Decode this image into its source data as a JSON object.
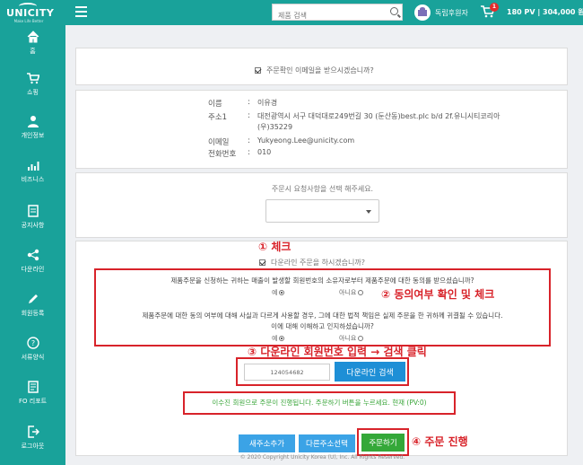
{
  "header": {
    "logo_text": "UNICITY",
    "logo_tagline": "Make Life Better",
    "search_placeholder": "제품 검색",
    "rank_label": "독립후원자",
    "cart_count": "1",
    "totals": "180 PV  |  304,000 원"
  },
  "sidebar": {
    "items": [
      {
        "label": "홈",
        "icon": "home-icon"
      },
      {
        "label": "쇼핑",
        "icon": "shopping-cart-icon"
      },
      {
        "label": "개인정보",
        "icon": "user-icon"
      },
      {
        "label": "비즈니스",
        "icon": "bar-chart-icon"
      },
      {
        "label": "공지사항",
        "icon": "notice-icon"
      },
      {
        "label": "다운라인",
        "icon": "network-icon"
      },
      {
        "label": "회원등록",
        "icon": "pencil-icon"
      },
      {
        "label": "서류양식",
        "icon": "help-icon"
      },
      {
        "label": "FO 리포트",
        "icon": "report-icon"
      },
      {
        "label": "로그아웃",
        "icon": "logout-icon"
      }
    ]
  },
  "email_confirm": {
    "label": "주문확인 이메일을 받으시겠습니까?",
    "checked": true
  },
  "customer": {
    "name_label": "이름",
    "name": "이유경",
    "address_label": "주소1",
    "address_line1": "대전광역시 서구 대덕대로249번길 30 (둔산동)best.plc b/d 2f.유니시티코리아",
    "address_line2": "(우)35229",
    "email_label": "이메일",
    "email": "Yukyeong.Lee@unicity.com",
    "phone_label": "전화번호",
    "phone": "010"
  },
  "request": {
    "prompt": "주문시 요청사항을 선택 해주세요.",
    "selected": ""
  },
  "downline": {
    "question": "다운라인 주문을 하시겠습니까?",
    "checked": true,
    "consent1": "제품주문을 신청하는 귀하는 매출이 발생할 회원번호의 소유자로부터 제품주문에 대한 동의를 받으셨습니까?",
    "consent2_line1": "제품주문에 대한 동의 여부에 대해 사실과 다르게 사용할 경우, 그에 대한 법적 책임은 실제 주문을 한 귀하께 귀결될 수 있습니다.",
    "consent2_line2": "이에 대해 이해하고 인지하셨습니까?",
    "yes_label": "예",
    "no_label": "아니요",
    "member_number": "124054682",
    "search_button": "다운라인 검색",
    "result": "이수진 회원으로 주문이 진행됩니다. 주문하기 버튼을 누르세요. 현재 (PV:0)"
  },
  "buttons": {
    "new_address": "새주소추가",
    "select_address": "다른주소선택",
    "order": "주문하기"
  },
  "footer": "© 2020 Copyright Unicity Korea (U), Inc. All Rights Reserved.",
  "annotations": {
    "step1": "① 체크",
    "step2": "② 동의여부 확인 및 체크",
    "step3": "③ 다운라인 회원번호 입력 → 검색 클릭",
    "step4": "④ 주문 진행"
  },
  "colors": {
    "brand_teal": "#19a29a",
    "annotation_red": "#d8232a",
    "button_blue": "#3ba3e6",
    "order_green": "#34a839"
  }
}
